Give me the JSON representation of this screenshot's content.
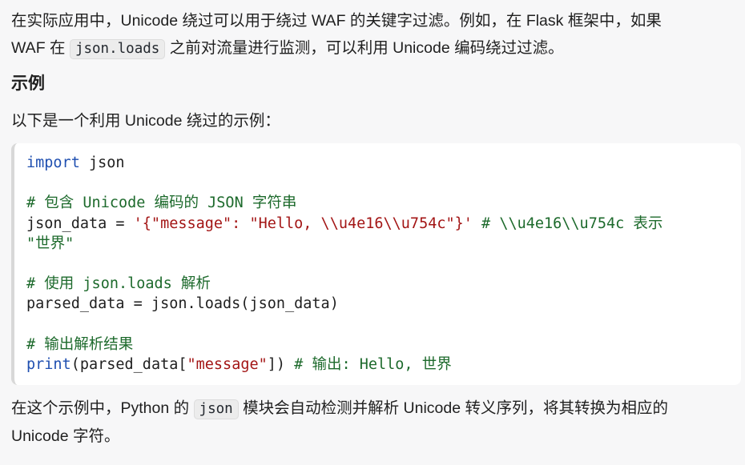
{
  "paragraph1": {
    "part1": "在实际应用中，Unicode 绕过可以用于绕过 WAF 的关键字过滤。例如，在 Flask 框架中，如果",
    "part2": "WAF 在 ",
    "code": "json.loads",
    "part3": " 之前对流量进行监测，可以利用 Unicode 编码绕过过滤。"
  },
  "heading": "示例",
  "paragraph2": "以下是一个利用 Unicode 绕过的示例：",
  "code_block": {
    "line1_kw": "import",
    "line1_rest": " json",
    "line3_comment": "# 包含 Unicode 编码的 JSON 字符串",
    "line4_var": "json_data = ",
    "line4_str": "'{\"message\": \"Hello, \\\\u4e16\\\\u754c\"}'",
    "line4_comment": " # \\\\u4e16\\\\u754c 表示",
    "line5_comment": "\"世界\"",
    "line7_comment": "# 使用 json.loads 解析",
    "line8": "parsed_data = json.loads(json_data)",
    "line10_comment": "# 输出解析结果",
    "line11_fn": "print",
    "line11_a": "(parsed_data[",
    "line11_str": "\"message\"",
    "line11_b": "]) ",
    "line11_comment": "# 输出: Hello, 世界"
  },
  "paragraph3": {
    "part1": "在这个示例中，Python 的 ",
    "code": "json",
    "part2": " 模块会自动检测并解析 Unicode 转义序列，将其转换为相应的",
    "part3": "Unicode 字符。"
  }
}
